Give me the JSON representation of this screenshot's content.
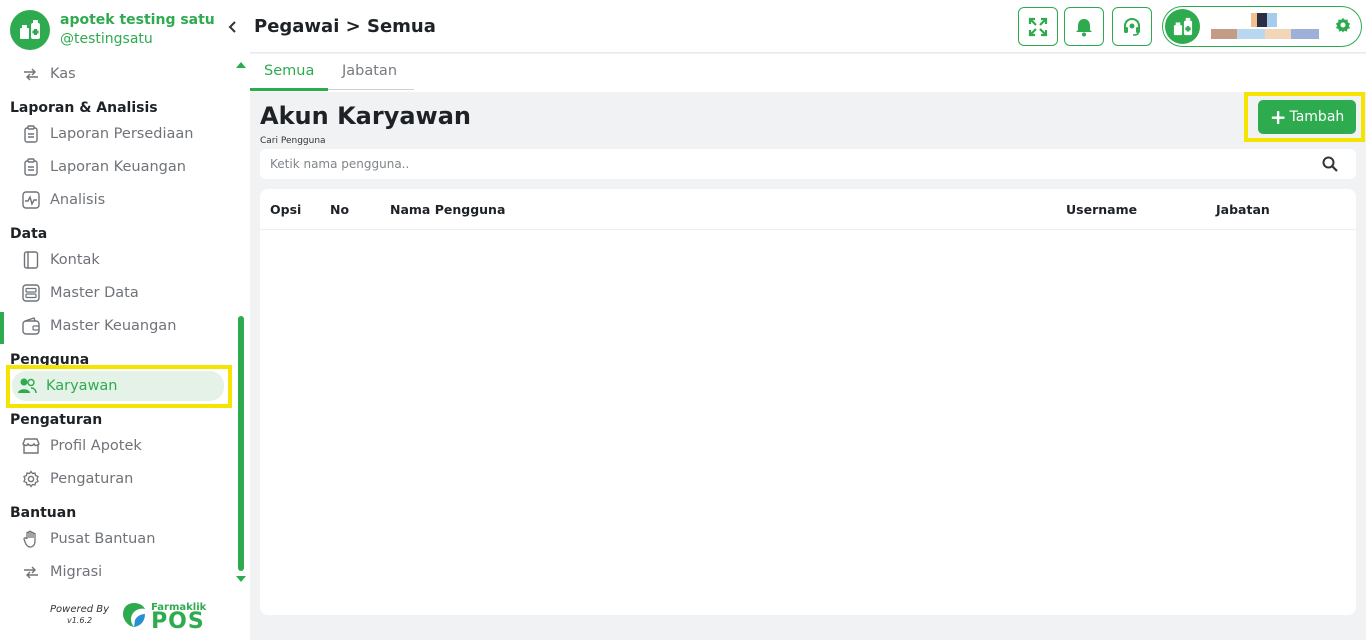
{
  "app": {
    "name": "apotek testing satu",
    "handle": "@testingsatu"
  },
  "sidebar": {
    "collapse_icon": "chevron-left-icon",
    "items": [
      {
        "label": "Kas",
        "icon": "transfer-icon"
      },
      {
        "section": "Laporan & Analisis"
      },
      {
        "label": "Laporan Persediaan",
        "icon": "clipboard-icon"
      },
      {
        "label": "Laporan Keuangan",
        "icon": "clipboard-icon"
      },
      {
        "label": "Analisis",
        "icon": "activity-icon"
      },
      {
        "section": "Data"
      },
      {
        "label": "Kontak",
        "icon": "contact-book-icon"
      },
      {
        "label": "Master Data",
        "icon": "database-icon"
      },
      {
        "label": "Master Keuangan",
        "icon": "wallet-icon"
      },
      {
        "section": "Pengguna"
      },
      {
        "label": "Karyawan",
        "icon": "users-icon",
        "active": true
      },
      {
        "section": "Pengaturan"
      },
      {
        "label": "Profil Apotek",
        "icon": "store-icon"
      },
      {
        "label": "Pengaturan",
        "icon": "gear-icon"
      },
      {
        "section": "Bantuan"
      },
      {
        "label": "Pusat Bantuan",
        "icon": "hand-icon"
      },
      {
        "label": "Migrasi",
        "icon": "transfer-icon"
      }
    ]
  },
  "footer": {
    "powered_by": "Powered By",
    "version": "v1.6.2",
    "brand_small": "Farmaklik",
    "brand_big": "POS"
  },
  "header": {
    "title": "Pegawai > Semua",
    "buttons": [
      "fullscreen-icon",
      "bell-icon",
      "headset-icon"
    ]
  },
  "tabs": [
    {
      "label": "Semua",
      "active": true
    },
    {
      "label": "Jabatan",
      "active": false
    }
  ],
  "main": {
    "heading": "Akun Karyawan",
    "search_label": "Cari Pengguna",
    "search_placeholder": "Ketik nama pengguna..",
    "add_button": "Tambah",
    "table": {
      "columns": [
        "Opsi",
        "No",
        "Nama Pengguna",
        "Username",
        "Jabatan"
      ],
      "rows": []
    }
  },
  "colors": {
    "accent": "#2eab4f",
    "highlight": "#f5e400"
  }
}
